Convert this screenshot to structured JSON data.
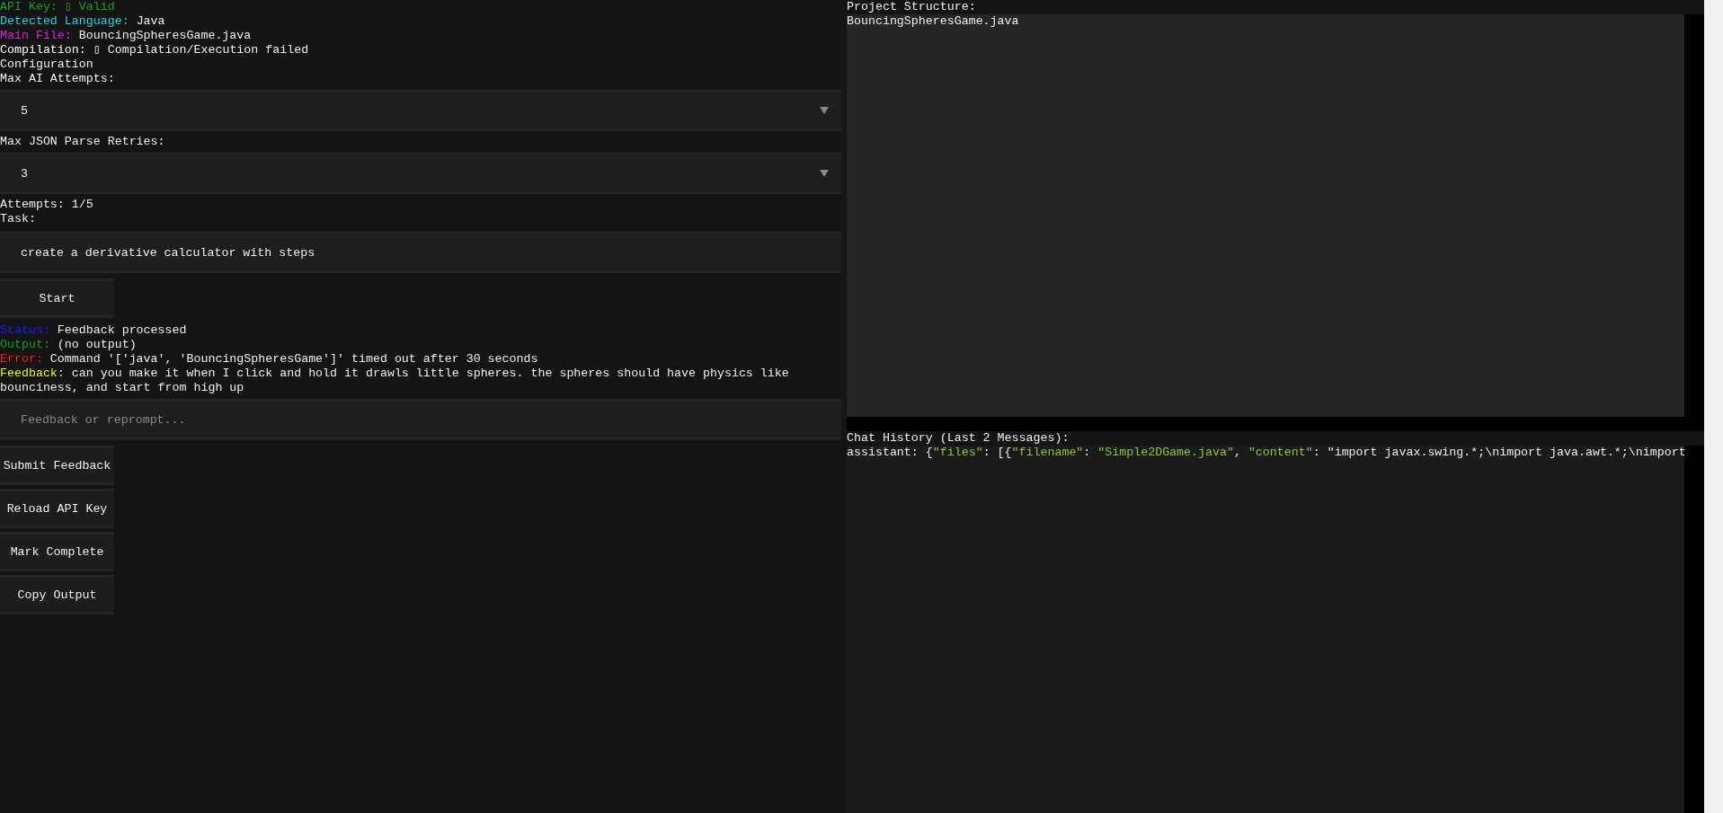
{
  "status_lines": [
    {
      "label": "API Key:",
      "value": "▯ Valid",
      "color": "#1f9e1f",
      "value_colored": true
    },
    {
      "label": "Detected Language:",
      "value": "Java",
      "color": "#1fd3e0",
      "value_colored": false
    },
    {
      "label": "Main File:",
      "value": "BouncingSpheresGame.java",
      "color": "#e01fe0",
      "value_colored": false
    },
    {
      "label": "Compilation:",
      "value": "▯ Compilation/Execution failed",
      "color": "#ffffff",
      "value_colored": false
    }
  ],
  "config": {
    "heading": "Configuration",
    "selects": [
      {
        "label": "Max AI Attempts:",
        "value": "5"
      },
      {
        "label": "Max JSON Parse Retries:",
        "value": "3"
      }
    ]
  },
  "attempts": "Attempts: 1/5",
  "task": {
    "label": "Task:",
    "value": "create a derivative calculator with steps"
  },
  "start_button": "Start",
  "results": [
    {
      "label": "Status:",
      "value": "Feedback processed",
      "color": "#1a1aff"
    },
    {
      "label": "Output:",
      "value": "(no output)",
      "color": "#1a9e1a"
    },
    {
      "label": "Error:",
      "value": "Command '['java', 'BouncingSpheresGame']' timed out after 30 seconds",
      "color": "#ff1a1a"
    },
    {
      "label": "Feedback:",
      "value": "can you make it when I click and hold it drawls little spheres. the spheres should have physics like bounciness, and start from high up",
      "color": "#f0f01a"
    }
  ],
  "feedback_field": {
    "placeholder": "Feedback or reprompt..."
  },
  "buttons": [
    "Submit Feedback",
    "Reload API Key",
    "Mark Complete",
    "Copy Output"
  ],
  "project": {
    "title": "Project Structure:",
    "files": [
      "BouncingSpheresGame.java"
    ]
  },
  "chat": {
    "title": "Chat History (Last 2 Messages):",
    "messages": [
      {
        "role": "assistant:",
        "parts": [
          {
            "text": "{",
            "kind": "plain"
          },
          {
            "text": "\"files\"",
            "kind": "key"
          },
          {
            "text": ": [{",
            "kind": "plain"
          },
          {
            "text": "\"filename\"",
            "kind": "key"
          },
          {
            "text": ": ",
            "kind": "plain"
          },
          {
            "text": "\"Simple2DGame.java\"",
            "kind": "key"
          },
          {
            "text": ", ",
            "kind": "plain"
          },
          {
            "text": "\"content\"",
            "kind": "key"
          },
          {
            "text": ": \"import javax.swing.*;\\nimport java.awt.*;\\nimport",
            "kind": "plain"
          }
        ]
      }
    ]
  }
}
